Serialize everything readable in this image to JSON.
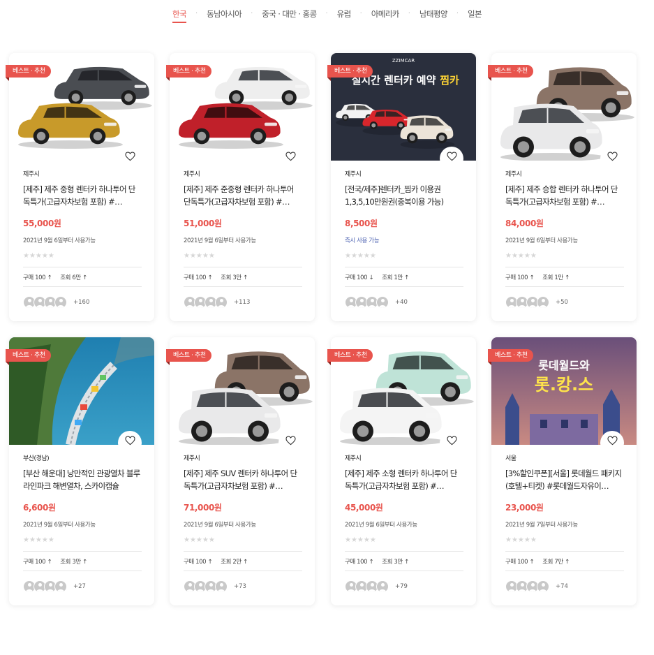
{
  "tabs": [
    {
      "label": "한국",
      "active": true
    },
    {
      "label": "동남아시아"
    },
    {
      "label": "중국 · 대만 · 홍콩"
    },
    {
      "label": "유럽"
    },
    {
      "label": "아메리카"
    },
    {
      "label": "남태평양"
    },
    {
      "label": "일본"
    }
  ],
  "tab_separator": "·",
  "badge_label": "베스트 · 추천",
  "rating_stars": "★★★★★",
  "products": [
    {
      "location": "제주시",
      "title": "[제주] 제주 중형 렌터카 하나투어 단독특가(고급자차보험 포함) #…",
      "price": "55,000원",
      "availability": "2021년 9월 6일부터 사용가능",
      "purchases": "구매 100 ↑",
      "views": "조회 6만 ↑",
      "extra_count": "+160",
      "image": "car-pair-sedan"
    },
    {
      "location": "제주시",
      "title": "[제주] 제주 준중형 렌터카 하나투어 단독특가(고급자차보험 포함) #…",
      "price": "51,000원",
      "availability": "2021년 9월 6일부터 사용가능",
      "purchases": "구매 100 ↑",
      "views": "조회 3만 ↑",
      "extra_count": "+113",
      "image": "car-pair-compact"
    },
    {
      "location": "제주시",
      "title": "[전국/제주]렌터카_찜카 이용권 1,3,5,10만원권(중복이용 가능)",
      "price": "8,500원",
      "availability": "즉시 사용 가능",
      "purchases": "구매 100 ↓",
      "views": "조회 1만 ↑",
      "extra_count": "+40",
      "image": "zzimcar-banner",
      "banner_brand": "ZZIMCAR",
      "banner_headline": "실시간 렌터카 예약",
      "banner_highlight": "찜카"
    },
    {
      "location": "제주시",
      "title": "[제주] 제주 승합 렌터카 하나투어 단독특가(고급자차보험 포함) #…",
      "price": "84,000원",
      "availability": "2021년 9월 6일부터 사용가능",
      "purchases": "구매 100 ↑",
      "views": "조회 1만 ↑",
      "extra_count": "+50",
      "image": "car-pair-van"
    },
    {
      "location": "부산(경남)",
      "title": "[부산 해운대] 낭만적인 관광열차 블루라인파크 해변열차, 스카이캡슐",
      "price": "6,600원",
      "availability": "2021년 9월 6일부터 사용가능",
      "purchases": "구매 100 ↑",
      "views": "조회 3만 ↑",
      "extra_count": "+27",
      "image": "coastal-train"
    },
    {
      "location": "제주시",
      "title": "[제주] 제주 SUV 렌터카 하나투어 단독특가(고급자차보험 포함) #…",
      "price": "71,000원",
      "availability": "2021년 9월 6일부터 사용가능",
      "purchases": "구매 100 ↑",
      "views": "조회 2만 ↑",
      "extra_count": "+73",
      "image": "car-pair-suv"
    },
    {
      "location": "제주시",
      "title": "[제주] 제주 소형 렌터카 하나투어 단독특가(고급자차보험 포함) #…",
      "price": "45,000원",
      "availability": "2021년 9월 6일부터 사용가능",
      "purchases": "구매 100 ↑",
      "views": "조회 3만 ↑",
      "extra_count": "+79",
      "image": "car-pair-small"
    },
    {
      "location": "서울",
      "title": "[3%할인쿠폰][서울] 롯데월드 패키지(호텔+티켓) #롯데월드자유이…",
      "price": "23,000원",
      "availability": "2021년 9월 7일부터 사용가능",
      "purchases": "구매 100 ↑",
      "views": "조회 7만 ↑",
      "extra_count": "+74",
      "image": "lotteworld-banner",
      "banner_headline": "롯데월드와",
      "banner_sub": "롯.캉.스"
    }
  ],
  "colors": {
    "accent": "#e8544d",
    "badge_shadow": "#8f2622",
    "availability_now": "#4a5fb0"
  }
}
